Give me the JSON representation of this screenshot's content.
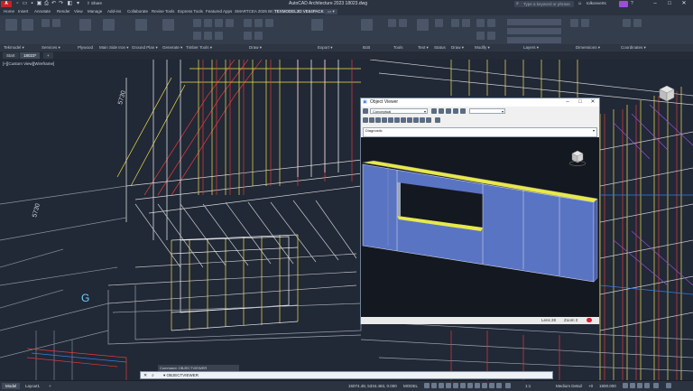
{
  "titlebar": {
    "app_button": "A",
    "title": "AutoCAD Architecture 2023  18023.dwg",
    "share_label": "Share",
    "search_placeholder": "Type a keyword or phrase",
    "user": "tolkonverts",
    "window_controls": [
      "–",
      "□",
      "✕"
    ]
  },
  "ribbon_tabs": [
    "Home",
    "Insert",
    "Annotate",
    "Render",
    "View",
    "Manage",
    "Add-ins",
    "Collaborate",
    "Revise Tools",
    "Express Tools",
    "Featured Apps",
    "SMARTCEA 2025 BIM",
    "TEXMODEL3D VE64PACK"
  ],
  "ribbon_active_tab": "TEXMODEL3D VE64PACK",
  "panel_titles": [
    "Tekmodel ▾",
    "Services ▾",
    "Plywood",
    "Main Side Iron ▾",
    "Ground Plan ▾",
    "Generate ▾",
    "Timber Tools ▾",
    "Draw ▾",
    "Export ▾",
    "BcB",
    "Tools",
    "Text ▾",
    "Status",
    "Draw ▾",
    "Modify ▾",
    "Layers ▾",
    "Dimensions ▾",
    "Coordinates ▾"
  ],
  "doc_tabs": [
    {
      "label": "Start",
      "active": false
    },
    {
      "label": "18023*",
      "active": true
    },
    {
      "label": "+",
      "active": false
    }
  ],
  "viewport": {
    "label": "[+][Custom View][Wireframe]",
    "annotations": [
      "5730",
      "5730",
      "G"
    ]
  },
  "object_viewer": {
    "title": "Object Viewer",
    "visual_style": "Conceptual",
    "view": "Diagnostic",
    "status_lens": "Lens 28",
    "status_zoom": "Zoom 2"
  },
  "command": {
    "history_line": "Command: OBJECTVIEWER",
    "prompt": "▾  OBJECTVIEWER"
  },
  "status_bar": {
    "layout_tabs": [
      {
        "label": "Model",
        "active": true
      },
      {
        "label": "Layout1",
        "active": false
      },
      {
        "label": "+",
        "active": false
      }
    ],
    "coordinates": "15074.48, 5334.483, 0.000",
    "model_label": "MODEL",
    "scale": "1:1",
    "detail": "Medium Detail",
    "elevation": "+0",
    "dim": "1800.000"
  },
  "colors": {
    "accent": "#c8202a",
    "ribbon_bg": "#343d4b",
    "viewport_bg": "#212836",
    "wall_face": "#5a74c4",
    "wall_top": "#e8e84a"
  }
}
